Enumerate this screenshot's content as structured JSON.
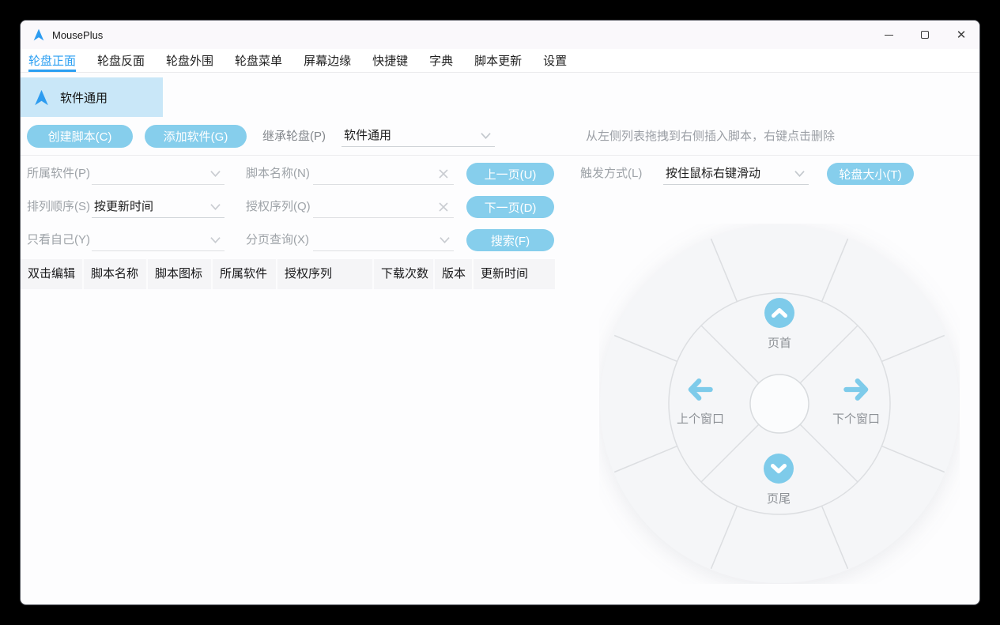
{
  "window": {
    "title": "MousePlus"
  },
  "tabs": [
    {
      "label": "轮盘正面",
      "active": true
    },
    {
      "label": "轮盘反面"
    },
    {
      "label": "轮盘外围"
    },
    {
      "label": "轮盘菜单"
    },
    {
      "label": "屏幕边缘"
    },
    {
      "label": "快捷键"
    },
    {
      "label": "字典"
    },
    {
      "label": "脚本更新"
    },
    {
      "label": "设置"
    }
  ],
  "wheel_list": {
    "selected_item": "软件通用"
  },
  "toolbar": {
    "create_script": "创建脚本(C)",
    "add_software": "添加软件(G)",
    "inherit_label": "继承轮盘(P)",
    "inherit_value": "软件通用",
    "hint": "从左侧列表拖拽到右侧插入脚本，右键点击删除"
  },
  "filters": {
    "row1": {
      "label": "所属软件(P)",
      "value": "",
      "field_label": "脚本名称(N)",
      "field_value": "",
      "button": "上一页(U)"
    },
    "row2": {
      "label": "排列顺序(S)",
      "value": "按更新时间",
      "field_label": "授权序列(Q)",
      "field_value": "",
      "button": "下一页(D)"
    },
    "row3": {
      "label": "只看自己(Y)",
      "value": "",
      "field_label": "分页查询(X)",
      "field_value": "",
      "button": "搜索(F)"
    }
  },
  "trigger": {
    "label": "触发方式(L)",
    "value": "按住鼠标右键滑动",
    "button": "轮盘大小(T)"
  },
  "table": {
    "headers": [
      "双击编辑",
      "脚本名称",
      "脚本图标",
      "所属软件",
      "授权序列",
      "下载次数",
      "版本",
      "更新时间"
    ]
  },
  "wheel": {
    "top": "页首",
    "left": "上个窗口",
    "right": "下个窗口",
    "bottom": "页尾"
  },
  "colors": {
    "accent": "#86ceec",
    "tab_active": "#2b9ff2",
    "selected_bg": "#c9e7f8",
    "logo_blue": "#2d9cf0"
  }
}
